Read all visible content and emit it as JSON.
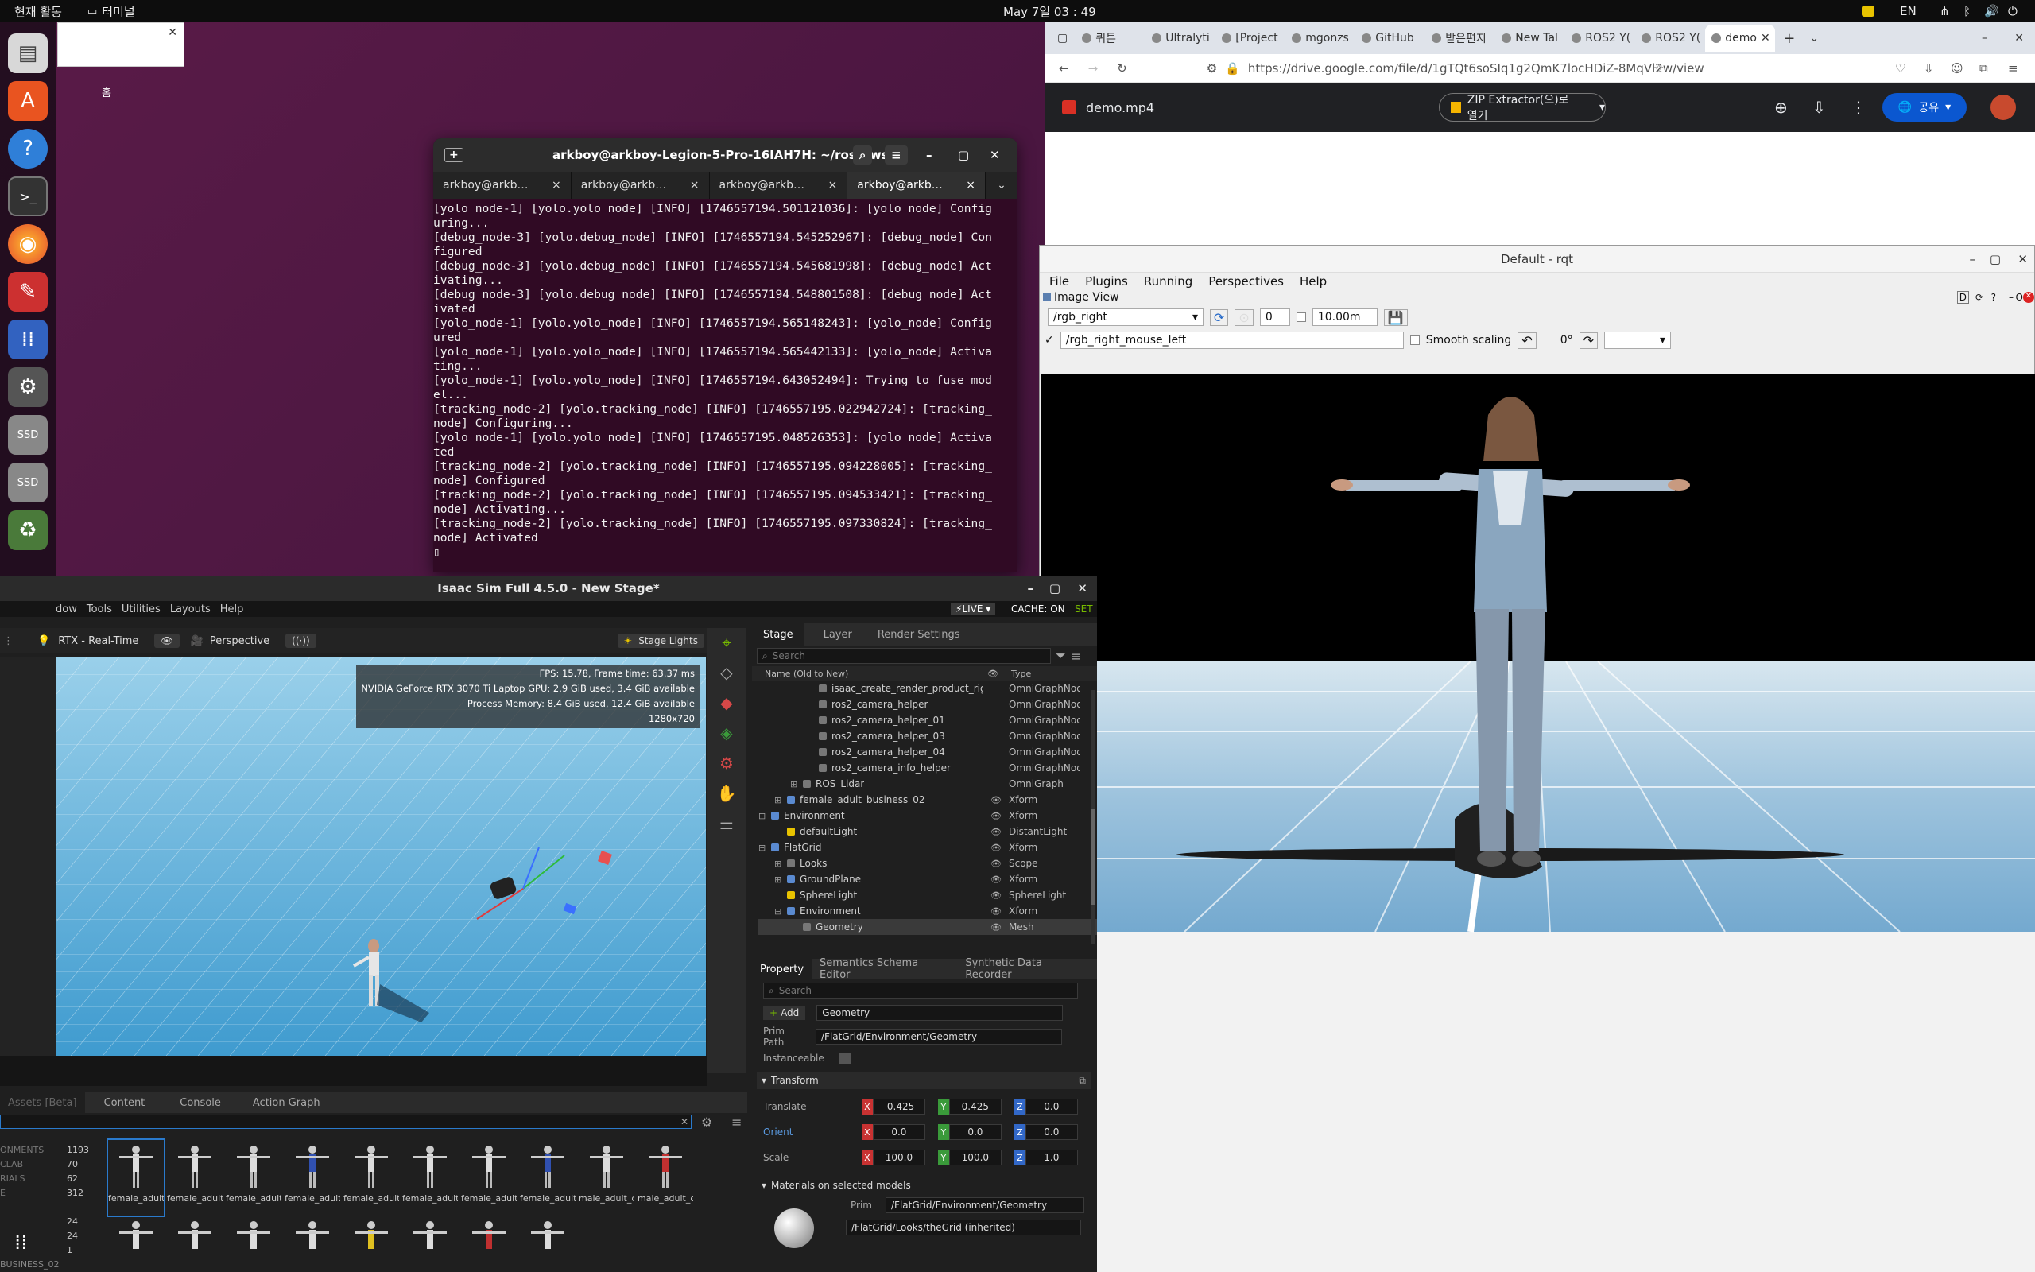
{
  "topbar": {
    "activities": "현재 활동",
    "app": "터미널",
    "clock": "May 7일  03 : 49",
    "lang": "EN"
  },
  "popup": {
    "label": "홈"
  },
  "terminal": {
    "title": "arkboy@arkboy-Legion-5-Pro-16IAH7H: ~/ros2_ws",
    "tabs": [
      "arkboy@arkb…",
      "arkboy@arkb…",
      "arkboy@arkb…",
      "arkboy@arkb…"
    ],
    "lines": [
      "[yolo_node-1] [yolo.yolo_node] [INFO] [1746557194.501121036]: [yolo_node] Config",
      "uring...",
      "[debug_node-3] [yolo.debug_node] [INFO] [1746557194.545252967]: [debug_node] Con",
      "figured",
      "[debug_node-3] [yolo.debug_node] [INFO] [1746557194.545681998]: [debug_node] Act",
      "ivating...",
      "[debug_node-3] [yolo.debug_node] [INFO] [1746557194.548801508]: [debug_node] Act",
      "ivated",
      "[yolo_node-1] [yolo.yolo_node] [INFO] [1746557194.565148243]: [yolo_node] Config",
      "ured",
      "[yolo_node-1] [yolo.yolo_node] [INFO] [1746557194.565442133]: [yolo_node] Activa",
      "ting...",
      "[yolo_node-1] [yolo.yolo_node] [INFO] [1746557194.643052494]: Trying to fuse mod",
      "el...",
      "[tracking_node-2] [yolo.tracking_node] [INFO] [1746557195.022942724]: [tracking_",
      "node] Configuring...",
      "[yolo_node-1] [yolo.yolo_node] [INFO] [1746557195.048526353]: [yolo_node] Activa",
      "ted",
      "[tracking_node-2] [yolo.tracking_node] [INFO] [1746557195.094228005]: [tracking_",
      "node] Configured",
      "[tracking_node-2] [yolo.tracking_node] [INFO] [1746557195.094533421]: [tracking_",
      "node] Activating...",
      "[tracking_node-2] [yolo.tracking_node] [INFO] [1746557195.097330824]: [tracking_",
      "node] Activated"
    ]
  },
  "isaac": {
    "title": "Isaac Sim Full 4.5.0 - New Stage*",
    "menu": [
      "dow",
      "Tools",
      "Utilities",
      "Layouts",
      "Help"
    ],
    "live": "LIVE",
    "cache": "CACHE: ON",
    "set": "SET",
    "viewport": {
      "render": "RTX - Real-Time",
      "camera": "Perspective",
      "lights": "Stage Lights",
      "stats": [
        "FPS: 15.78, Frame time: 63.37 ms",
        "NVIDIA GeForce RTX 3070 Ti Laptop GPU: 2.9 GiB used, 3.4 GiB available",
        "Process Memory: 8.4 GiB used, 12.4 GiB available",
        "1280x720"
      ]
    },
    "stage_tabs": [
      "Stage",
      "Layer",
      "Render Settings"
    ],
    "stage_search": "Search",
    "stage_cols": {
      "name": "Name (Old to New)",
      "type": "Type"
    },
    "stage_rows": [
      {
        "name": "isaac_create_render_product_rig",
        "type": "OmniGraphNode",
        "indent": 3,
        "exp": "",
        "eye": false
      },
      {
        "name": "ros2_camera_helper",
        "type": "OmniGraphNode",
        "indent": 3,
        "exp": "",
        "eye": false
      },
      {
        "name": "ros2_camera_helper_01",
        "type": "OmniGraphNode",
        "indent": 3,
        "exp": "",
        "eye": false
      },
      {
        "name": "ros2_camera_helper_03",
        "type": "OmniGraphNode",
        "indent": 3,
        "exp": "",
        "eye": false
      },
      {
        "name": "ros2_camera_helper_04",
        "type": "OmniGraphNode",
        "indent": 3,
        "exp": "",
        "eye": false
      },
      {
        "name": "ros2_camera_info_helper",
        "type": "OmniGraphNode",
        "indent": 3,
        "exp": "",
        "eye": false
      },
      {
        "name": "ROS_Lidar",
        "type": "OmniGraph",
        "indent": 2,
        "exp": "+",
        "eye": false
      },
      {
        "name": "female_adult_business_02",
        "type": "Xform",
        "indent": 1,
        "exp": "+",
        "eye": true
      },
      {
        "name": "Environment",
        "type": "Xform",
        "indent": 0,
        "exp": "-",
        "eye": true
      },
      {
        "name": "defaultLight",
        "type": "DistantLight",
        "indent": 1,
        "exp": "",
        "eye": true
      },
      {
        "name": "FlatGrid",
        "type": "Xform",
        "indent": 0,
        "exp": "-",
        "eye": true
      },
      {
        "name": "Looks",
        "type": "Scope",
        "indent": 1,
        "exp": "+",
        "eye": true
      },
      {
        "name": "GroundPlane",
        "type": "Xform",
        "indent": 1,
        "exp": "+",
        "eye": true
      },
      {
        "name": "SphereLight",
        "type": "SphereLight",
        "indent": 1,
        "exp": "",
        "eye": true
      },
      {
        "name": "Environment",
        "type": "Xform",
        "indent": 1,
        "exp": "-",
        "eye": true
      },
      {
        "name": "Geometry",
        "type": "Mesh",
        "indent": 2,
        "exp": "",
        "eye": true
      }
    ],
    "prop_tabs": [
      "Property",
      "Semantics Schema Editor",
      "Synthetic Data Recorder"
    ],
    "prop_search": "Search",
    "add_label": "Add",
    "prim_name": "Geometry",
    "prim_path_label": "Prim Path",
    "prim_path": "/FlatGrid/Environment/Geometry",
    "instanceable_label": "Instanceable",
    "transform_label": "Transform",
    "translate_label": "Translate",
    "translate": [
      "-0.425",
      "0.425",
      "0.0"
    ],
    "orient_label": "Orient",
    "orient": [
      "0.0",
      "0.0",
      "0.0"
    ],
    "scale_label": "Scale",
    "scale": [
      "100.0",
      "100.0",
      "1.0"
    ],
    "materials_label": "Materials on selected models",
    "mat_prim_label": "Prim",
    "mat_prim": "/FlatGrid/Environment/Geometry",
    "mat_inherited": "/FlatGrid/Looks/theGrid (inherited)",
    "bottom_tabs": [
      "Assets [Beta]",
      "Content",
      "Console",
      "Action Graph"
    ],
    "side_labels": [
      {
        "t": "ONMENTS",
        "n": ""
      },
      {
        "t": "CLAB",
        "n": ""
      },
      {
        "t": "RIALS",
        "n": ""
      },
      {
        "t": "E",
        "n": ""
      },
      {
        "t": "",
        "n": "312"
      }
    ],
    "counts": [
      "1193",
      "70",
      "62",
      "312",
      "24",
      "24",
      "1"
    ],
    "assets": [
      "female_adult_bu...s_02",
      "female_adult_me...al_01",
      "female_adult_police_01",
      "female_adult_poli..._new",
      "female_adult_police_02",
      "female_adult_police_02",
      "female_adult_police_03",
      "female_adult_poli..._new",
      "male_adult_cons...n_01",
      "male_adult_cons..._new"
    ],
    "bottom_label": "BUSINESS_02"
  },
  "browser": {
    "tabs": [
      "퀴튼",
      "Ultralyti",
      "[Project",
      "mgonzs",
      "GitHub",
      "받은편지",
      "New Tal",
      "ROS2 Y(",
      "ROS2 Y(",
      "demo"
    ],
    "url": "https://drive.google.com/file/d/1gTQt6soSIq1g2QmK7locHDiZ-8MqVl2w/view",
    "file": "demo.mp4",
    "open_with": "ZIP Extractor(으)로 열기",
    "share": "공유"
  },
  "rqt": {
    "title": "Default - rqt",
    "menu": [
      "File",
      "Plugins",
      "Running",
      "Perspectives",
      "Help"
    ],
    "plugin": "Image View",
    "topic": "/rgb_right",
    "spin_value": "0",
    "max_value": "10.00m",
    "mouse_topic": "/rgb_right_mouse_left",
    "smooth_label": "Smooth scaling",
    "rotation": "0°",
    "badge": "D"
  },
  "colors": {
    "accent": "#76b900",
    "terminal_bg": "#300a24",
    "drive_blue": "#0b57d0"
  }
}
